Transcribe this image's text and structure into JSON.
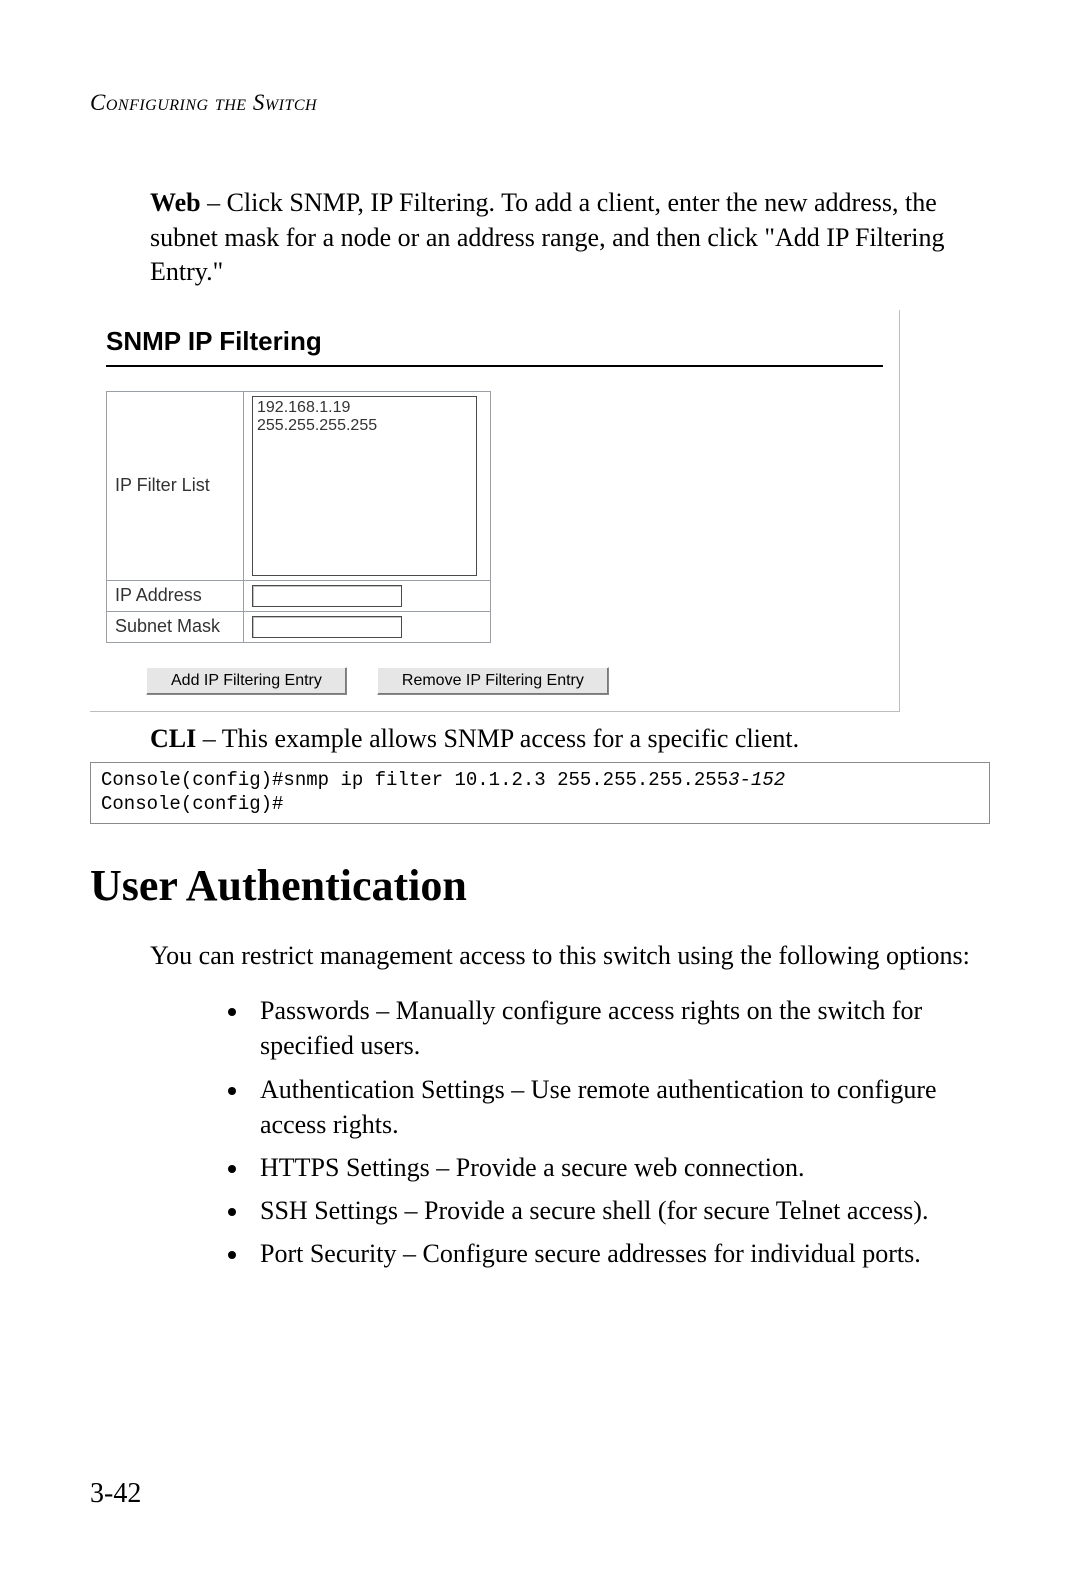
{
  "header": {
    "running_head": "Configuring the Switch"
  },
  "web_para": {
    "lead": "Web",
    "text": " – Click SNMP, IP Filtering. To add a client, enter the new address, the subnet mask for a node or an address range, and then click \"Add IP Filtering Entry.\""
  },
  "ui": {
    "title": "SNMP IP Filtering",
    "rows": {
      "filter_list_label": "IP Filter List",
      "filter_list_value": "192.168.1.19 255.255.255.255",
      "ip_address_label": "IP Address",
      "ip_address_value": "",
      "subnet_mask_label": "Subnet Mask",
      "subnet_mask_value": ""
    },
    "buttons": {
      "add": "Add IP Filtering Entry",
      "remove": "Remove IP Filtering Entry"
    }
  },
  "cli_para": {
    "lead": "CLI",
    "text": " – This example allows SNMP access for a specific client."
  },
  "code": {
    "line1_cmd": "Console(config)#snmp ip filter 10.1.2.3 255.255.255.255",
    "line1_ref": "3-152",
    "line2": "Console(config)#"
  },
  "section": {
    "title": "User Authentication"
  },
  "auth_para": "You can restrict management access to this switch using the following options:",
  "options": [
    "Passwords – Manually configure access rights on the switch for specified users.",
    "Authentication Settings – Use remote authentication to configure access rights.",
    "HTTPS Settings – Provide a secure web connection.",
    "SSH Settings – Provide a secure shell (for secure Telnet access).",
    "Port Security – Configure secure addresses for individual ports."
  ],
  "page_number": "3-42"
}
